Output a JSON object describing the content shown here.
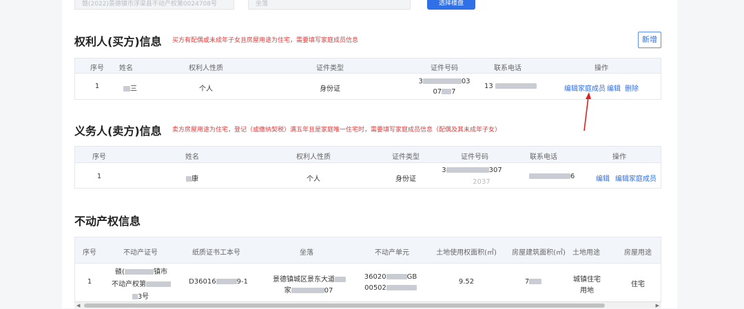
{
  "top": {
    "input1_value": "赣(2022)景德镇市浮梁县不动产权第0024708号",
    "input2_placeholder": "坐落",
    "button_label": "选择楼盘"
  },
  "buyer": {
    "title": "权利人(买方)信息",
    "note": "买方有配偶或未成年子女且房屋用途为住宅，需要填写家庭成员信息",
    "add_label": "新增",
    "headers": [
      "序号",
      "姓名",
      "权利人性质",
      "证件类型",
      "证件号码",
      "联系电话",
      "操作"
    ],
    "row": {
      "index": "1",
      "name_suffix": "三",
      "nature": "个人",
      "id_type": "身份证",
      "id_line1_start": "3",
      "id_line1_end": "03",
      "id_line2_start": "07",
      "id_line2_end": "7",
      "phone_start": "13",
      "action_family": "编辑家庭成员",
      "action_edit": "编辑",
      "action_delete": "删除"
    }
  },
  "seller": {
    "title": "义务人(卖方)信息",
    "note": "卖方房屋用途为住宅，登记（或缴纳契税）满五年且是家庭唯一住宅时，需要填写家庭成员信息（配偶及其未成年子女）",
    "headers": [
      "序号",
      "姓名",
      "权利人性质",
      "证件类型",
      "证件号码",
      "联系电话",
      "操作"
    ],
    "row": {
      "index": "1",
      "name_suffix": "康",
      "nature": "个人",
      "id_type": "身份证",
      "id_line1_start": "3",
      "id_line1_end": "307",
      "id_line2": "2037",
      "phone_end": "6",
      "action_edit": "编辑",
      "action_family": "编辑家庭成员"
    }
  },
  "property": {
    "title": "不动产权信息",
    "headers": [
      "序号",
      "不动产证号",
      "纸质证书工本号",
      "坐落",
      "不动产单元",
      "土地使用权面积(㎡)",
      "房屋建筑面积(㎡)",
      "土地用途",
      "房屋用途"
    ],
    "row": {
      "index": "1",
      "cert_line1_start": "赣(",
      "cert_line1_end": "镇市",
      "cert_line2_start": "不动产权第",
      "cert_line3_end": "3号",
      "paper_start": "D36016",
      "paper_end": "9-1",
      "location_line1_start": "景德镇城区景东大道",
      "location_line2_start": "家",
      "location_line2_end": "07",
      "unit_line1_start": "36020",
      "unit_line1_end": "GB",
      "unit_line2_start": "00502",
      "land_area": "9.52",
      "building_area_start": "7",
      "land_use_line1": "城镇住宅",
      "land_use_line2": "用地",
      "house_use": "住宅"
    }
  }
}
